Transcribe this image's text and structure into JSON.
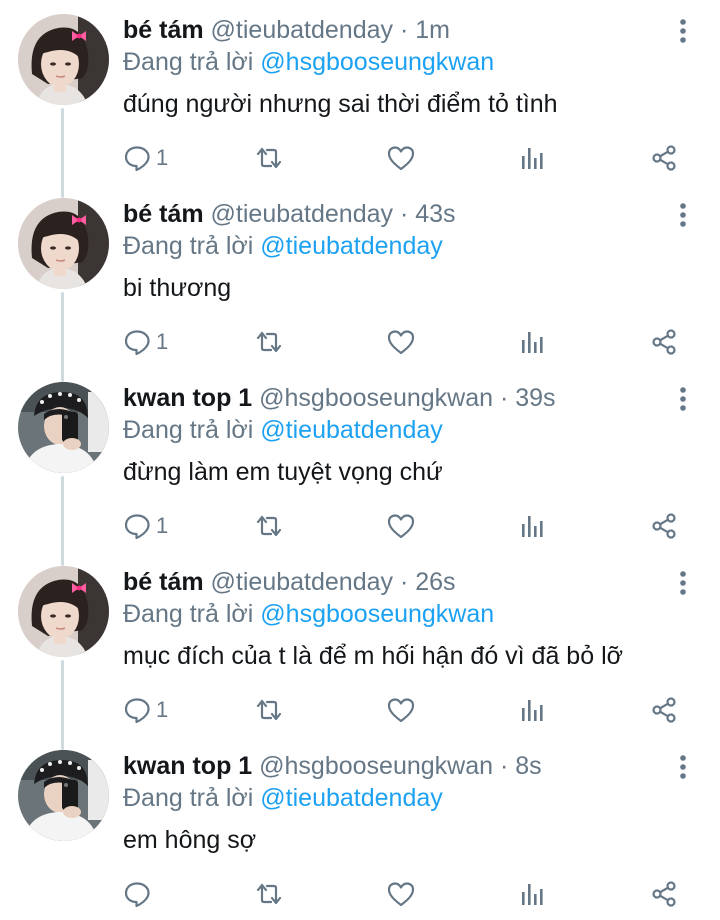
{
  "icons": {
    "reply": "reply-bubble-icon",
    "retweet": "retweet-icon",
    "like": "heart-icon",
    "analytics": "analytics-bars-icon",
    "share": "share-icon",
    "more": "more-vertical-icon"
  },
  "colors": {
    "mention": "#1da1f2",
    "secondary_text": "#657786",
    "primary_text": "#14171a",
    "thread_line": "#cfd9de",
    "icon": "#657786"
  },
  "tweets": [
    {
      "name": "bé tám",
      "handle": "@tieubatdenday",
      "separator": "·",
      "time": "1m",
      "reply_prefix": "Đang trả lời",
      "reply_to": "@hsgbooseungkwan",
      "text": "đúng người nhưng sai thời điểm tỏ tình",
      "reply_count": "1",
      "avatar": "pink-bow"
    },
    {
      "name": "bé tám",
      "handle": "@tieubatdenday",
      "separator": "·",
      "time": "43s",
      "reply_prefix": "Đang trả lời",
      "reply_to": "@tieubatdenday",
      "text": "bi thương",
      "reply_count": "1",
      "avatar": "pink-bow"
    },
    {
      "name": "kwan top 1",
      "handle": "@hsgbooseungkwan",
      "separator": "·",
      "time": "39s",
      "reply_prefix": "Đang trả lời",
      "reply_to": "@tieubatdenday",
      "text": "đừng làm em tuyệt vọng chứ",
      "reply_count": "1",
      "avatar": "mirror-selfie"
    },
    {
      "name": "bé tám",
      "handle": "@tieubatdenday",
      "separator": "·",
      "time": "26s",
      "reply_prefix": "Đang trả lời",
      "reply_to": "@hsgbooseungkwan",
      "text": "mục đích của t là để m hối hận đó vì đã bỏ lỡ",
      "reply_count": "1",
      "avatar": "pink-bow"
    },
    {
      "name": "kwan top 1",
      "handle": "@hsgbooseungkwan",
      "separator": "·",
      "time": "8s",
      "reply_prefix": "Đang trả lời",
      "reply_to": "@tieubatdenday",
      "text": "em hông sợ",
      "reply_count": "",
      "avatar": "mirror-selfie"
    }
  ]
}
